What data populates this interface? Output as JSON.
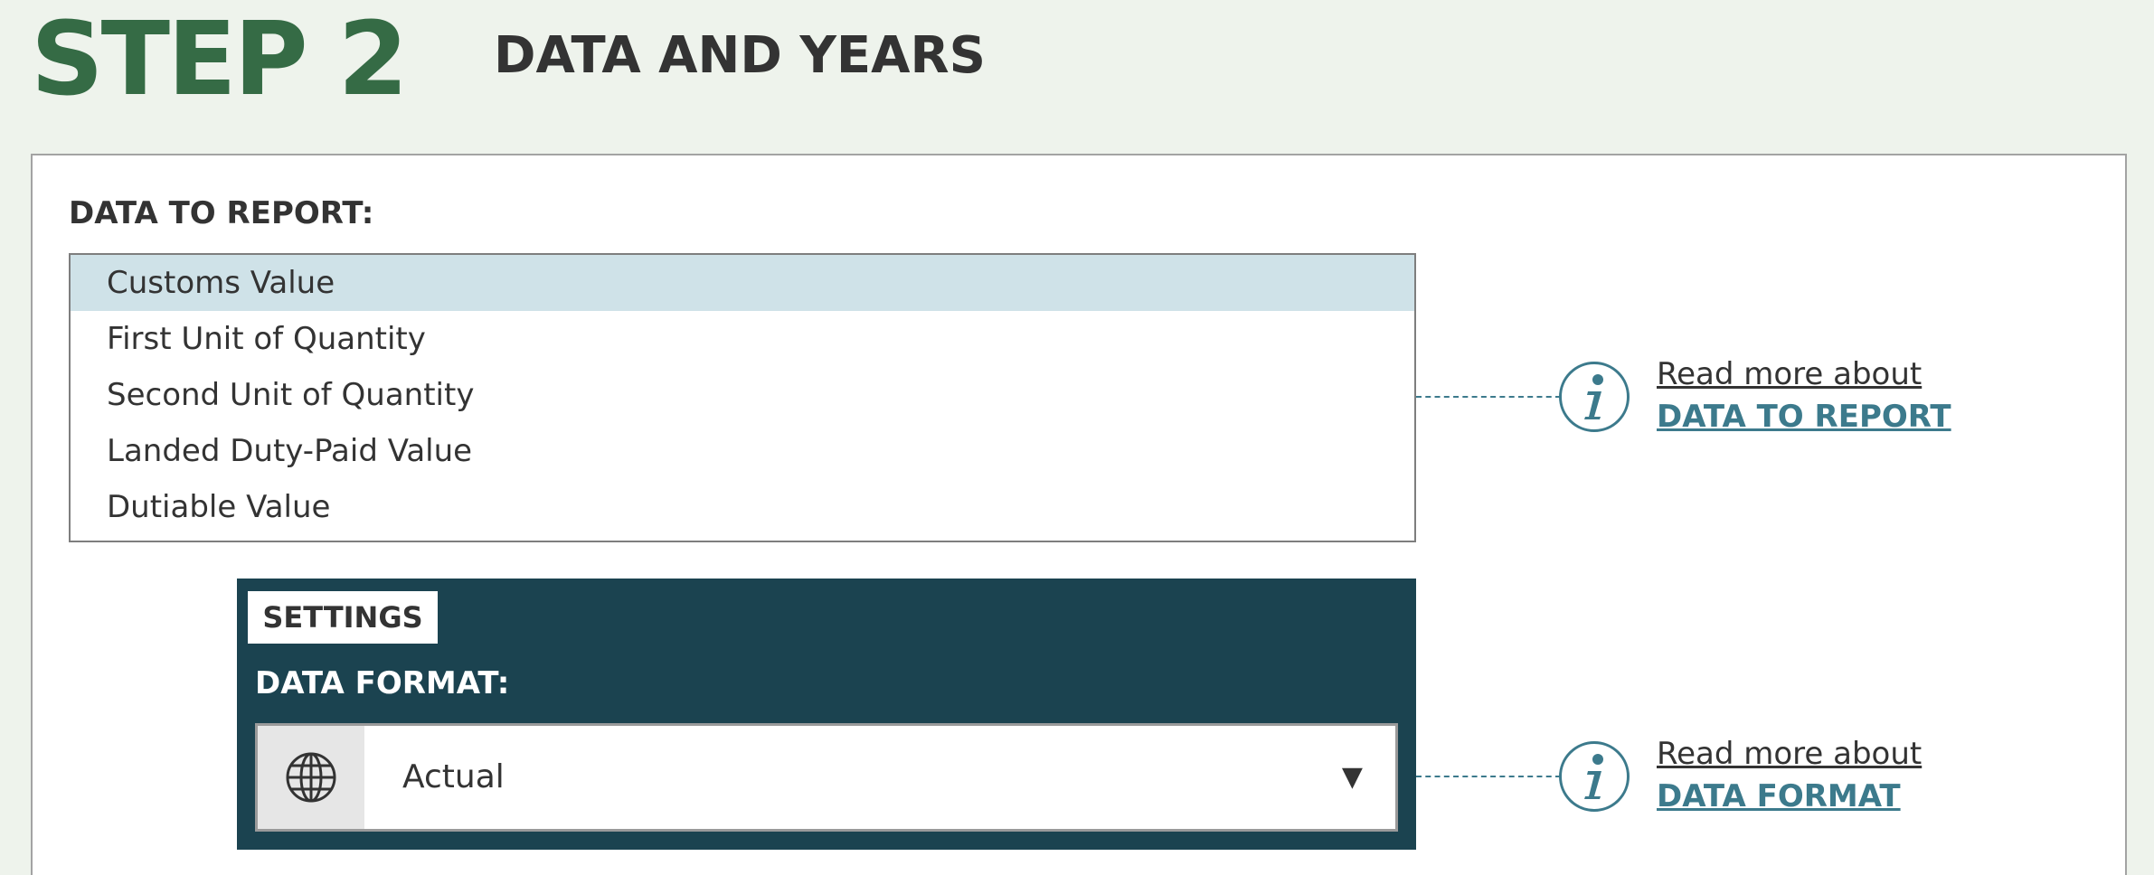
{
  "step": {
    "number_label": "STEP 2",
    "title": "DATA AND YEARS"
  },
  "data_to_report": {
    "label": "DATA TO REPORT:",
    "options": [
      "Customs Value",
      "First Unit of Quantity",
      "Second Unit of Quantity",
      "Landed Duty-Paid Value",
      "Dutiable Value"
    ],
    "selected_index": 0,
    "info": {
      "read_more": "Read more about",
      "topic": "DATA TO REPORT"
    }
  },
  "settings": {
    "tag": "SETTINGS",
    "data_format": {
      "label": "DATA FORMAT:",
      "value": "Actual",
      "arrow": "▼",
      "icon": "globe-icon",
      "info": {
        "read_more": "Read more about",
        "topic": "DATA FORMAT"
      }
    }
  },
  "colors": {
    "page_background": "#eef3ec",
    "step_green": "#356b45",
    "settings_background": "#1b4350",
    "accent_teal": "#3c7a8c",
    "selected_option": "#cfe2e8"
  }
}
